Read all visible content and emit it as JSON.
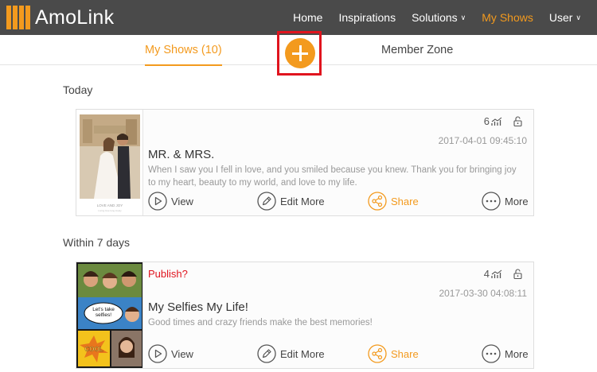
{
  "header": {
    "logo_text": "AmoLink",
    "nav": [
      {
        "label": "Home",
        "dropdown": false,
        "active": false
      },
      {
        "label": "Inspirations",
        "dropdown": false,
        "active": false
      },
      {
        "label": "Solutions",
        "dropdown": true,
        "active": false
      },
      {
        "label": "My Shows",
        "dropdown": false,
        "active": true
      },
      {
        "label": "User",
        "dropdown": true,
        "active": false
      }
    ]
  },
  "tabs": {
    "my_shows": "My Shows (10)",
    "member_zone": "Member Zone"
  },
  "sections": [
    {
      "title": "Today",
      "shows": [
        {
          "publish_label": "",
          "views": "6",
          "date": "2017-04-01 09:45:10",
          "title": "MR. & MRS.",
          "description": "When I saw you I fell in love, and you smiled because you knew. Thank you for bringing joy to my heart, beauty to my world, and love to my life.",
          "thumb_caption": "LOVE AND JOY",
          "thumb_subcaption": "Living love long lovely"
        }
      ]
    },
    {
      "title": "Within 7 days",
      "shows": [
        {
          "publish_label": "Publish?",
          "views": "4",
          "date": "2017-03-30 04:08:11",
          "title": "My Selfies My Life!",
          "description": "Good times and crazy friends make the best memories!",
          "thumb_bubble": "Let's take selfies!",
          "thumb_burst": "COOL"
        }
      ]
    }
  ],
  "actions": {
    "view": "View",
    "edit": "Edit More",
    "share": "Share",
    "more": "More"
  },
  "colors": {
    "accent": "#f39a1e",
    "header_bg": "#4a4a4a",
    "highlight": "#e0141e",
    "publish": "#e0141e"
  }
}
